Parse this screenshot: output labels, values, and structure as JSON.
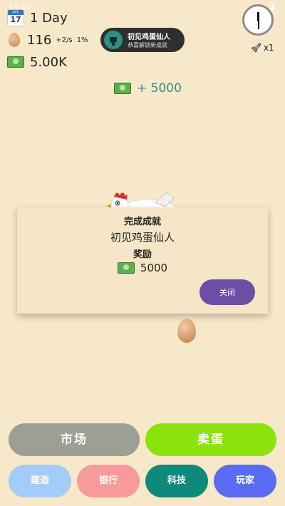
{
  "status_bar": {
    "time": "11:05",
    "icons": "▾ ▮"
  },
  "stats": {
    "calendar_month": "July",
    "calendar_day": "17",
    "day_label": "1 Day",
    "egg_count": "116",
    "egg_rate": "+2/s",
    "egg_percent": "1%",
    "money": "5.00K"
  },
  "achievement_toast": {
    "title": "初见鸡蛋仙人",
    "subtitle": "恭喜解锁新成就"
  },
  "speed": {
    "multiplier": "x1"
  },
  "gain": {
    "text": "+ 5000"
  },
  "dialog": {
    "heading": "完成成就",
    "achievement_name": "初见鸡蛋仙人",
    "reward_label": "奖励",
    "reward_amount": "5000",
    "close_label": "关闭"
  },
  "actions": {
    "market": "市场",
    "sell_eggs": "卖蛋",
    "build": "建造",
    "bank": "银行",
    "tech": "科技",
    "player": "玩家"
  },
  "colors": {
    "background": "#f7e8c9",
    "market_button": "#9c9f93",
    "sell_button": "#8be30c",
    "build_button": "#a3cdf8",
    "bank_button": "#f79a9a",
    "tech_button": "#0e8a7a",
    "player_button": "#586bf2",
    "close_button": "#6a4fa5",
    "gain_text": "#2d8f8c"
  },
  "icons": {
    "calendar": "calendar-icon",
    "egg": "egg-icon",
    "money": "money-icon",
    "trophy": "trophy-icon",
    "clock": "clock-icon",
    "rocket": "rocket-icon",
    "chicken": "chicken-icon"
  }
}
